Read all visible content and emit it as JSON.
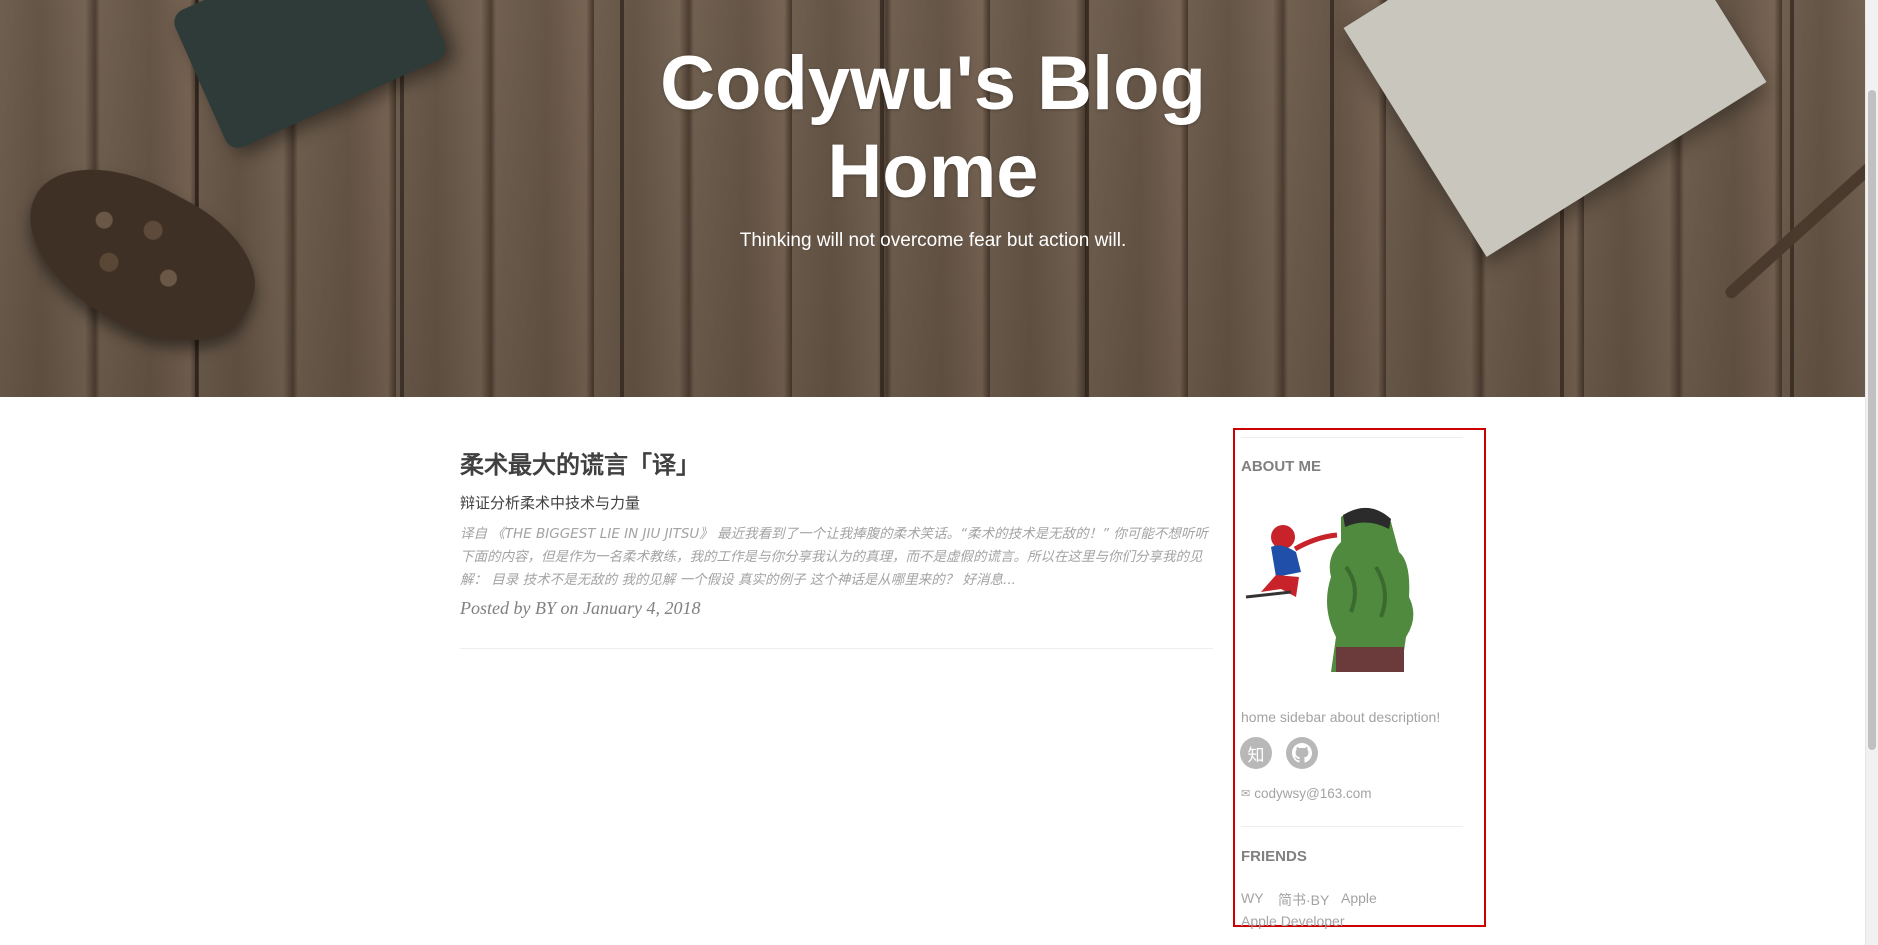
{
  "header": {
    "title_line1": "Codywu's Blog",
    "title_line2": "Home",
    "subtitle": "Thinking will not overcome fear but action will."
  },
  "post": {
    "title": "柔术最大的谎言「译」",
    "subtitle": "辩证分析柔术中技术与力量",
    "excerpt": "译自 《THE BIGGEST LIE IN JIU JITSU》 最近我看到了一个让我捧腹的柔术笑话。“柔术的技术是无敌的！” 你可能不想听听下面的内容，但是作为一名柔术教练，我的工作是与你分享我认为的真理，而不是虚假的谎言。所以在这里与你们分享我的见解：  目录 技术不是无敌的 我的见解 一个假设 真实的例子 这个神话是从哪里来的？ 好消息...",
    "meta": "Posted by BY on January 4, 2018"
  },
  "sidebar": {
    "about_heading": "ABOUT ME",
    "avatar_icon": "spiderman-hulk-avatar",
    "description": "home sidebar about description!",
    "social": [
      {
        "label": "知",
        "icon": "zhihu-icon"
      },
      {
        "label": "",
        "icon": "github-icon"
      }
    ],
    "email": "codywsy@163.com",
    "friends_heading": "FRIENDS",
    "friends": [
      "WY",
      "简书·BY",
      "Apple",
      "Apple Developer"
    ]
  },
  "colors": {
    "heading_text": "#404040",
    "muted_text": "#a3a3a3",
    "highlight_border": "#cc0000",
    "social_bg": "#b8b8b8"
  }
}
